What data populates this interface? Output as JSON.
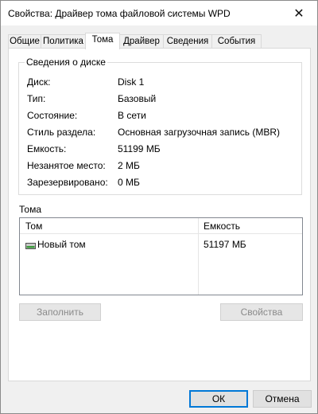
{
  "window": {
    "title": "Свойства: Драйвер тома файловой системы WPD"
  },
  "tabs": [
    {
      "label": "Общие"
    },
    {
      "label": "Политика"
    },
    {
      "label": "Тома"
    },
    {
      "label": "Драйвер"
    },
    {
      "label": "Сведения"
    },
    {
      "label": "События"
    }
  ],
  "active_tab": "Тома",
  "disk_info": {
    "legend": "Сведения о диске",
    "rows": [
      {
        "label": "Диск:",
        "value": "Disk 1"
      },
      {
        "label": "Тип:",
        "value": "Базовый"
      },
      {
        "label": "Состояние:",
        "value": "В сети"
      },
      {
        "label": "Стиль раздела:",
        "value": "Основная загрузочная запись (MBR)"
      },
      {
        "label": "Емкость:",
        "value": "51199 МБ"
      },
      {
        "label": "Незанятое место:",
        "value": "2 МБ"
      },
      {
        "label": "Зарезервировано:",
        "value": "0 МБ"
      }
    ]
  },
  "volumes": {
    "label": "Тома",
    "columns": [
      "Том",
      "Емкость"
    ],
    "rows": [
      {
        "name": "Новый том",
        "capacity": "51197 МБ",
        "icon": "drive-icon"
      }
    ]
  },
  "panel_buttons": {
    "populate": "Заполнить",
    "properties": "Свойства"
  },
  "dialog_buttons": {
    "ok": "ОК",
    "cancel": "Отмена"
  },
  "colors": {
    "accent": "#0078d7",
    "window_bg": "#f0f0f0"
  }
}
